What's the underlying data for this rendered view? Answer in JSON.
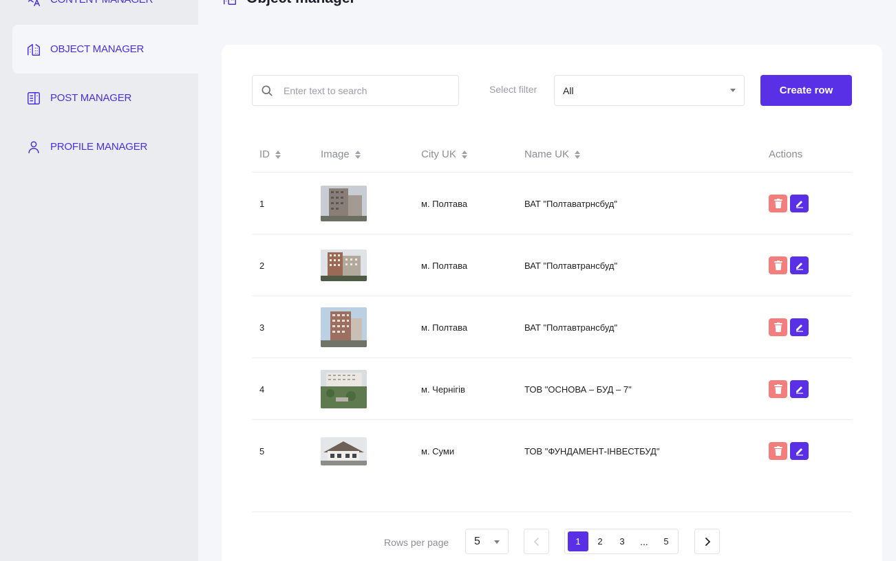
{
  "sidebar": {
    "items": [
      {
        "label": "CONTENT MANAGER",
        "icon": "translate-icon",
        "active": false
      },
      {
        "label": "OBJECT MANAGER",
        "icon": "building-icon",
        "active": true
      },
      {
        "label": "POST MANAGER",
        "icon": "document-icon",
        "active": false
      },
      {
        "label": "PROFILE MANAGER",
        "icon": "user-icon",
        "active": false
      }
    ]
  },
  "header": {
    "title": "Object manager",
    "icon": "building-icon"
  },
  "toolbar": {
    "search_placeholder": "Enter text to search",
    "search_value": "",
    "filter_label": "Select filter",
    "filter_value": "All",
    "create_label": "Create row"
  },
  "table": {
    "columns": [
      "ID",
      "Image",
      "City UK",
      "Name UK",
      "Actions"
    ],
    "rows": [
      {
        "id": "1",
        "city": "м. Полтава",
        "name": "ВАТ \"Полтаватрнсбуд\""
      },
      {
        "id": "2",
        "city": "м. Полтава",
        "name": "ВАТ \"Полтавтрансбуд\""
      },
      {
        "id": "3",
        "city": "м. Полтава",
        "name": "ВАТ \"Полтавтрансбуд\""
      },
      {
        "id": "4",
        "city": "м. Чернігів",
        "name": "ТОВ \"ОСНОВА – БУД – 7\""
      },
      {
        "id": "5",
        "city": "м. Суми",
        "name": "ТОВ \"ФУНДАМЕНТ-ІНВЕСТБУД\""
      }
    ]
  },
  "pagination": {
    "rows_label": "Rows per page",
    "rows_value": "5",
    "pages": [
      "1",
      "2",
      "3"
    ],
    "ellipsis": "...",
    "last_page": "5",
    "current_page": "1"
  },
  "colors": {
    "accent": "#5a30e6",
    "delete": "#f47e7e",
    "nav_text": "#4a2ee0"
  }
}
